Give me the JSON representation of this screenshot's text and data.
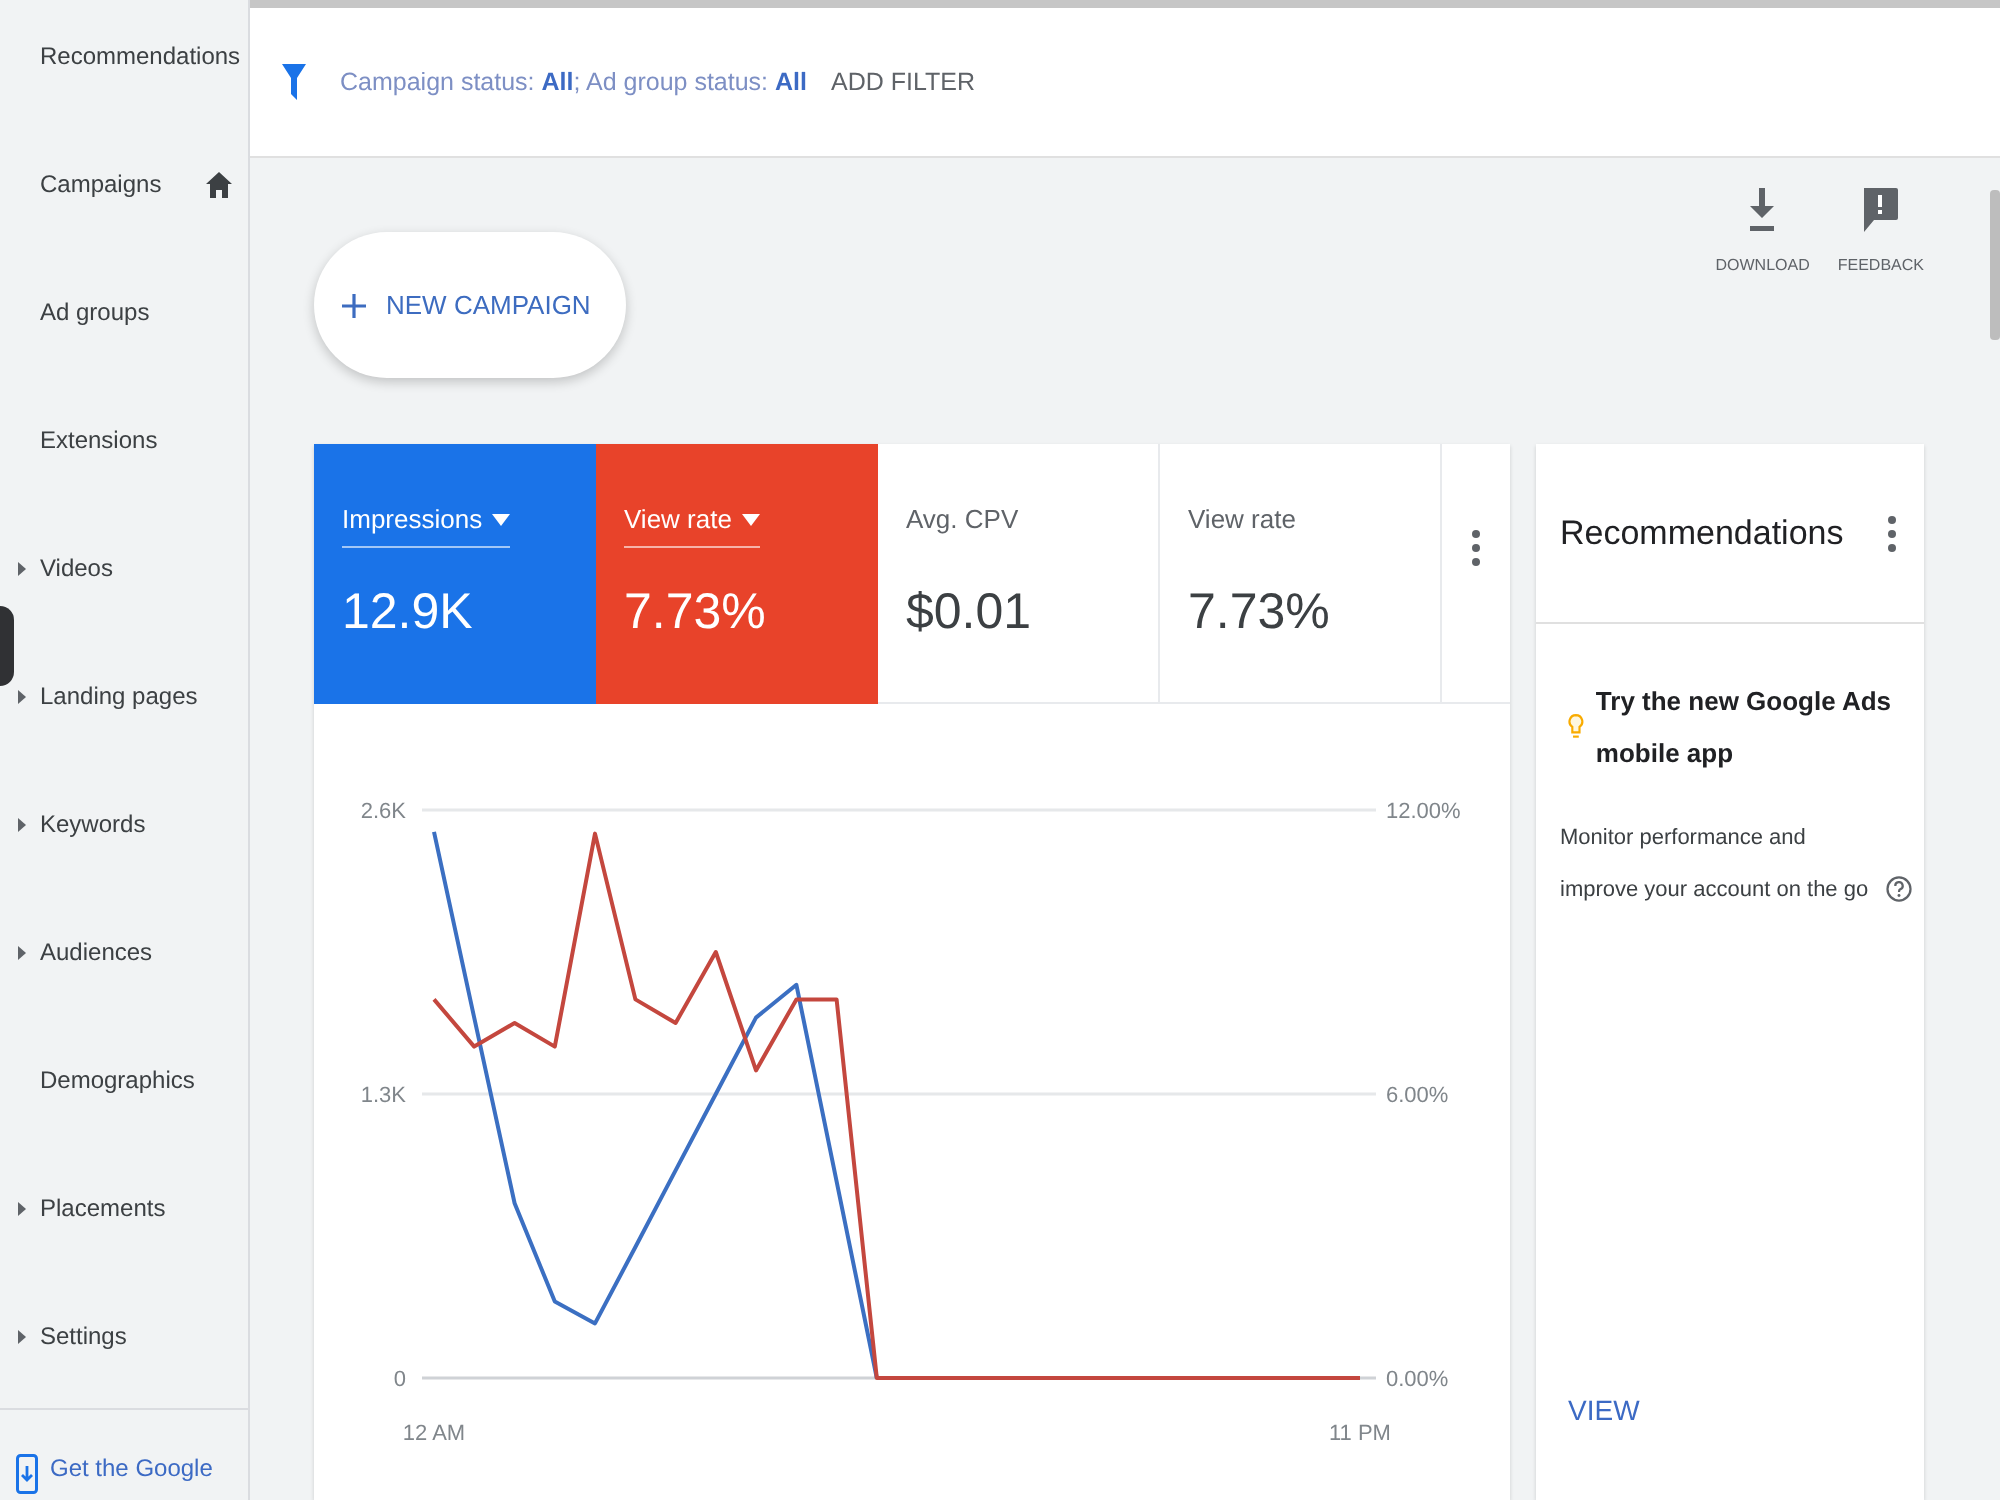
{
  "sidebar": {
    "items": [
      {
        "label": "Recommendations",
        "kind": "page",
        "home": false
      },
      {
        "label": "Campaigns",
        "kind": "page",
        "home": true
      },
      {
        "label": "Ad groups",
        "kind": "page",
        "home": false
      },
      {
        "label": "Extensions",
        "kind": "page",
        "home": false
      },
      {
        "label": "Videos",
        "kind": "group",
        "home": false
      },
      {
        "label": "Landing pages",
        "kind": "group",
        "home": false
      },
      {
        "label": "Keywords",
        "kind": "group",
        "home": false
      },
      {
        "label": "Audiences",
        "kind": "group",
        "home": false
      },
      {
        "label": "Demographics",
        "kind": "page",
        "home": false
      },
      {
        "label": "Placements",
        "kind": "group",
        "home": false
      },
      {
        "label": "Settings",
        "kind": "group",
        "home": false
      }
    ],
    "promo": {
      "text": "Get the Google"
    }
  },
  "filter_bar": {
    "summary": "Campaign status: **All**; Ad group status: **All**",
    "add_filter": "ADD FILTER"
  },
  "toolbar": {
    "new_campaign": "NEW CAMPAIGN",
    "actions": [
      {
        "kind": "download",
        "label": "DOWNLOAD"
      },
      {
        "kind": "feedback",
        "label": "FEEDBACK"
      }
    ]
  },
  "performance": {
    "metrics": [
      {
        "label": "Impressions",
        "value": "12.9K",
        "selected": true,
        "color": "#1a73e8"
      },
      {
        "label": "View rate",
        "value": "7.73%",
        "selected": true,
        "color": "#e8432a"
      },
      {
        "label": "Avg. CPV",
        "value": "$0.01",
        "selected": false
      },
      {
        "label": "View rate",
        "value": "7.73%",
        "selected": false
      }
    ],
    "chart_data": {
      "type": "line",
      "categories": [
        "12 AM",
        null,
        null,
        null,
        null,
        null,
        null,
        null,
        null,
        null,
        null,
        null,
        null,
        null,
        null,
        null,
        null,
        null,
        null,
        null,
        null,
        null,
        null,
        "11 PM"
      ],
      "ylim": [
        0,
        2600
      ],
      "yticks": [
        {
          "value": 0,
          "label": "0"
        },
        {
          "value": 1300,
          "label": "1.3K"
        },
        {
          "value": 2600,
          "label": "2.6K"
        }
      ],
      "y2lim": [
        0,
        12
      ],
      "y2ticks": [
        {
          "value": 0,
          "label": "0.00%"
        },
        {
          "value": 6,
          "label": "6.00%"
        },
        {
          "value": 12,
          "label": "12.00%"
        }
      ],
      "series": [
        {
          "color": "#3b6fc2",
          "values": [
            2500,
            1650,
            800,
            350,
            250,
            600,
            950,
            1300,
            1650,
            1800,
            900,
            0,
            null,
            null,
            null,
            null,
            null,
            null,
            null,
            null,
            null,
            null,
            null,
            null
          ]
        },
        {
          "color": "#c4473e",
          "axis": "y2",
          "values": [
            8,
            7,
            7.5,
            7,
            11.5,
            8,
            7.5,
            9,
            6.5,
            8,
            8,
            0,
            0,
            0,
            0,
            0,
            0,
            0,
            0,
            0,
            0,
            0,
            0,
            0
          ]
        }
      ]
    }
  },
  "recommendations": {
    "title": "Recommendations",
    "items": [
      {
        "title": "Try the new Google Ads mobile app",
        "description": "Monitor performance and improve your account on the go",
        "action": "VIEW"
      }
    ]
  }
}
